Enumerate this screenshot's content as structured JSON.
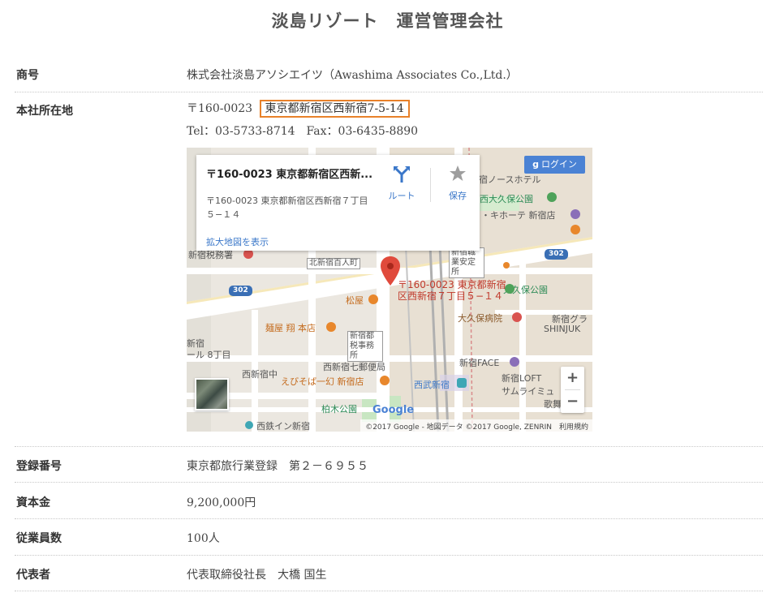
{
  "title": "淡島リゾート　運営管理会社",
  "rows": [
    {
      "label": "商号",
      "value": "株式会社淡島アソシエイツ（Awashima Associates Co.,Ltd.）"
    },
    {
      "label": "本社所在地",
      "postal": "〒160-0023",
      "address": "東京都新宿区西新宿7-5-14",
      "tel": "Tel：03-5733-8714　Fax：03-6435-8890"
    },
    {
      "label": "登録番号",
      "value": "東京都旅行業登録　第２－６９５５"
    },
    {
      "label": "資本金",
      "value": "9,200,000円"
    },
    {
      "label": "従業員数",
      "value": "100人"
    },
    {
      "label": "代表者",
      "value": "代表取締役社長　大橋 国生"
    }
  ],
  "map": {
    "info_title": "〒160-0023 東京都新宿区西新...",
    "info_address": "〒160-0023 東京都新宿区西新宿７丁目５−１４",
    "info_link": "拡大地図を表示",
    "route_label": "ルート",
    "save_label": "保存",
    "login_label": "ログイン",
    "zoom_in": "+",
    "zoom_out": "−",
    "pin_label": "〒160-0023 東京都新宿区西新宿７丁目５−１４",
    "copyright": "©2017 Google - 地図データ ©2017 Google, ZENRIN　利用規約",
    "labels": {
      "hotel": "宿ノースホテル",
      "nishiokubo_park": "西大久保公園",
      "donki": "・キホーテ 新宿店",
      "tax_office": "新宿税務署",
      "kitashinjuku": "北新宿百人町",
      "shokugyo": "新宿職業安定所",
      "okubo_park": "大久保公園",
      "matsuya": "松屋",
      "okubo_hospital": "大久保病院",
      "shinjuku_gra": "新宿グラ",
      "shinjuku_en": "SHINJUK",
      "menya": "麺屋 翔 本店",
      "tax_office2": "新宿都税事務所",
      "nishishinjuku_side": "新宿",
      "area_8": "ール 8丁目",
      "nishishinjuku_naka": "西新宿中",
      "post_office": "西新宿七郵便局",
      "face": "新宿FACE",
      "ebisoba": "えびそば一幻 新宿店",
      "seibu": "西武新宿",
      "loft": "新宿LOFT",
      "samuraimu": "サムライミュ",
      "kabuki": "歌舞",
      "kashiwagi": "柏木公園",
      "nishitetsu": "西鉄イン新宿",
      "google": "Google",
      "route_302a": "302",
      "route_302b": "302"
    }
  }
}
